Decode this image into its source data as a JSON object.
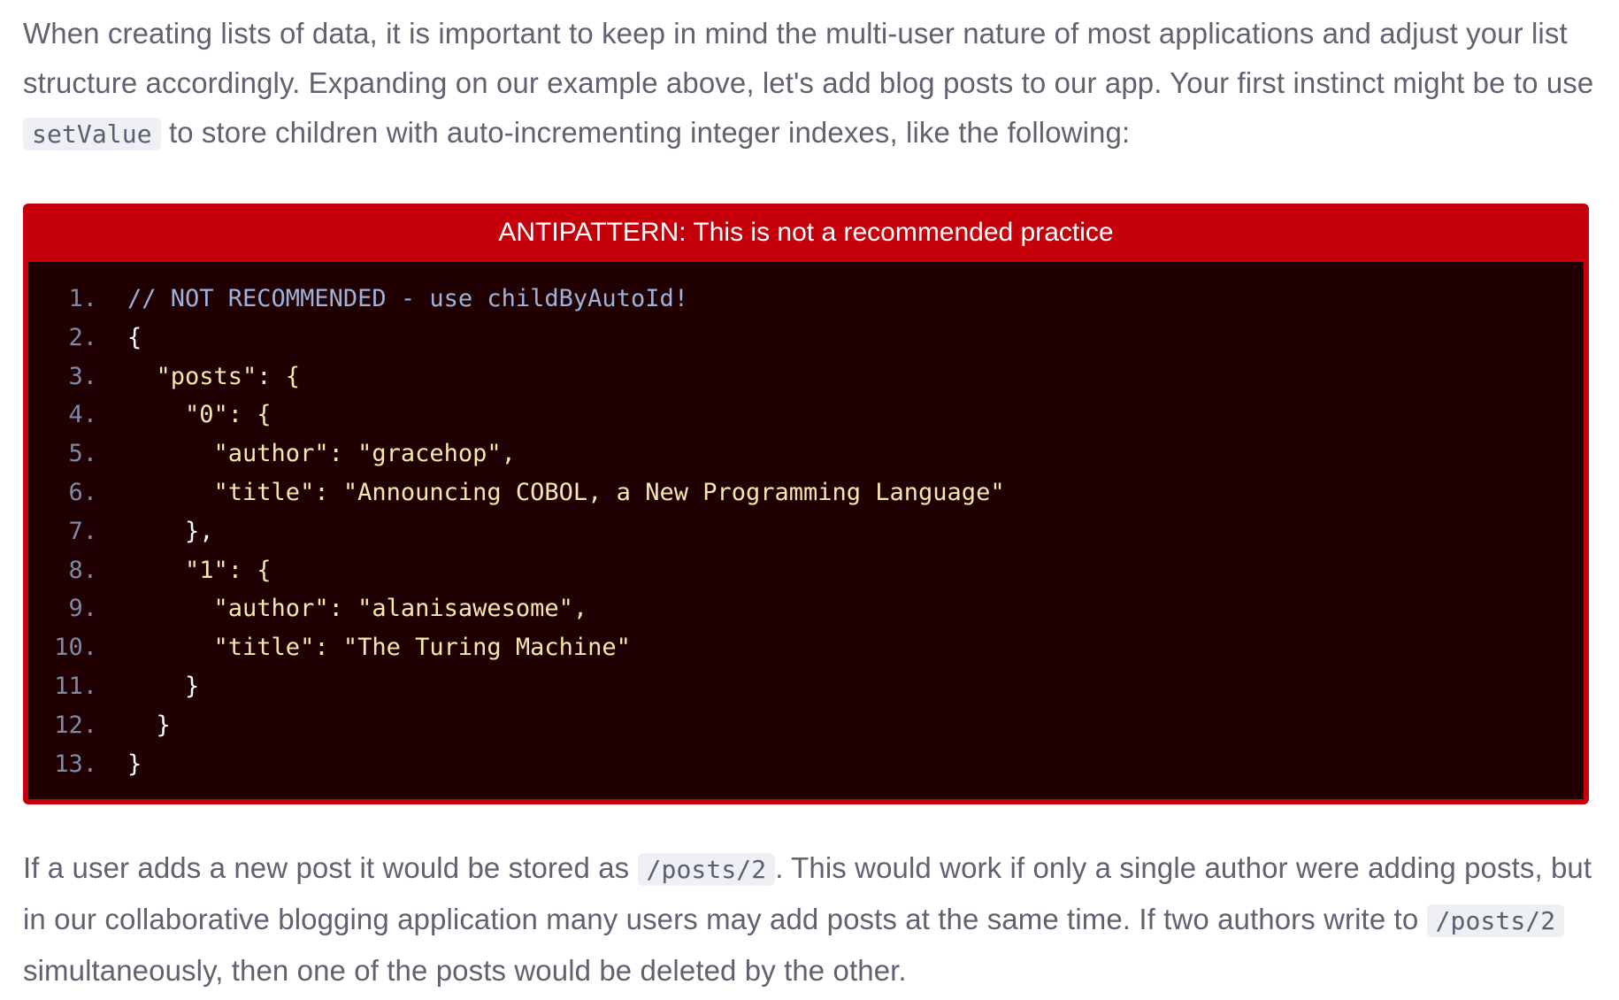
{
  "intro": {
    "before": "When creating lists of data, it is important to keep in mind the multi-user nature of most applications and adjust your list structure accordingly. Expanding on our example above, let's add blog posts to our app. Your first instinct might be to use ",
    "code": "setValue",
    "after": " to store children with auto-incrementing integer indexes, like the following:"
  },
  "callout": {
    "title": "ANTIPATTERN: This is not a recommended practice",
    "accent_color": "#c5000b",
    "code_background": "#200003"
  },
  "code": {
    "lines": [
      {
        "num": "1.",
        "text": "// NOT RECOMMENDED - use childByAutoId!"
      },
      {
        "num": "2.",
        "text": "{"
      },
      {
        "num": "3.",
        "text": "  \"posts\": {"
      },
      {
        "num": "4.",
        "text": "    \"0\": {"
      },
      {
        "num": "5.",
        "text": "      \"author\": \"gracehop\","
      },
      {
        "num": "6.",
        "text": "      \"title\": \"Announcing COBOL, a New Programming Language\""
      },
      {
        "num": "7.",
        "text": "    },"
      },
      {
        "num": "8.",
        "text": "    \"1\": {"
      },
      {
        "num": "9.",
        "text": "      \"author\": \"alanisawesome\","
      },
      {
        "num": "10.",
        "text": "      \"title\": \"The Turing Machine\""
      },
      {
        "num": "11.",
        "text": "    }"
      },
      {
        "num": "12.",
        "text": "  }"
      },
      {
        "num": "13.",
        "text": "}"
      }
    ]
  },
  "outro": {
    "part1": "If a user adds a new post it would be stored as ",
    "code1": "/posts/2",
    "part2": ". This would work if only a single author were adding posts, but in our collaborative blogging application many users may add posts at the same time. If two authors write to ",
    "code2": "/posts/2",
    "part3": " simultaneously, then one of the posts would be deleted by the other."
  }
}
